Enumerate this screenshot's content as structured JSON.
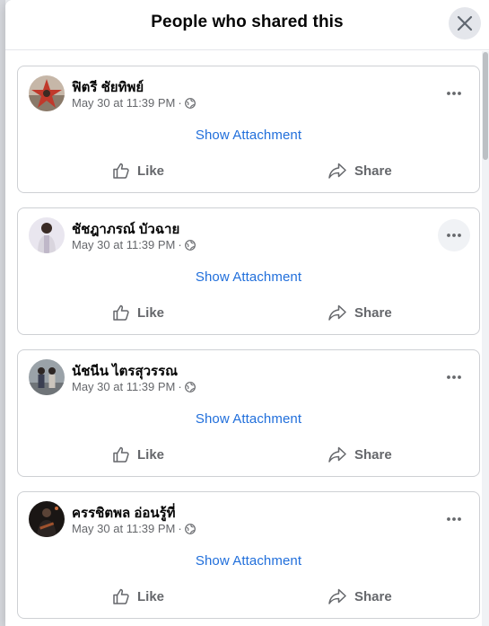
{
  "dialog": {
    "title": "People who shared this",
    "close_icon": "close-icon"
  },
  "colors": {
    "link": "#216fdb",
    "secondary_text": "#65676b",
    "card_border": "#ced0d4"
  },
  "shares": [
    {
      "author": "ฟิตรี ชัยทิพย์",
      "time": "May 30 at 11:39 PM",
      "attachment_label": "Show Attachment",
      "like_label": "Like",
      "share_label": "Share"
    },
    {
      "author": "ชัชฎาภรณ์ บัวฉาย",
      "time": "May 30 at 11:39 PM",
      "attachment_label": "Show Attachment",
      "like_label": "Like",
      "share_label": "Share"
    },
    {
      "author": "นัชนีน ไตรสุวรรณ",
      "time": "May 30 at 11:39 PM",
      "attachment_label": "Show Attachment",
      "like_label": "Like",
      "share_label": "Share"
    },
    {
      "author": "ครรชิตพล อ่อนรู้ที่",
      "time": "May 30 at 11:39 PM",
      "attachment_label": "Show Attachment",
      "like_label": "Like",
      "share_label": "Share"
    }
  ],
  "meta_separator": "·",
  "icons": {
    "privacy": "globe-icon",
    "more": "more-options-icon",
    "like": "thumbs-up-icon",
    "share": "share-arrow-icon"
  }
}
